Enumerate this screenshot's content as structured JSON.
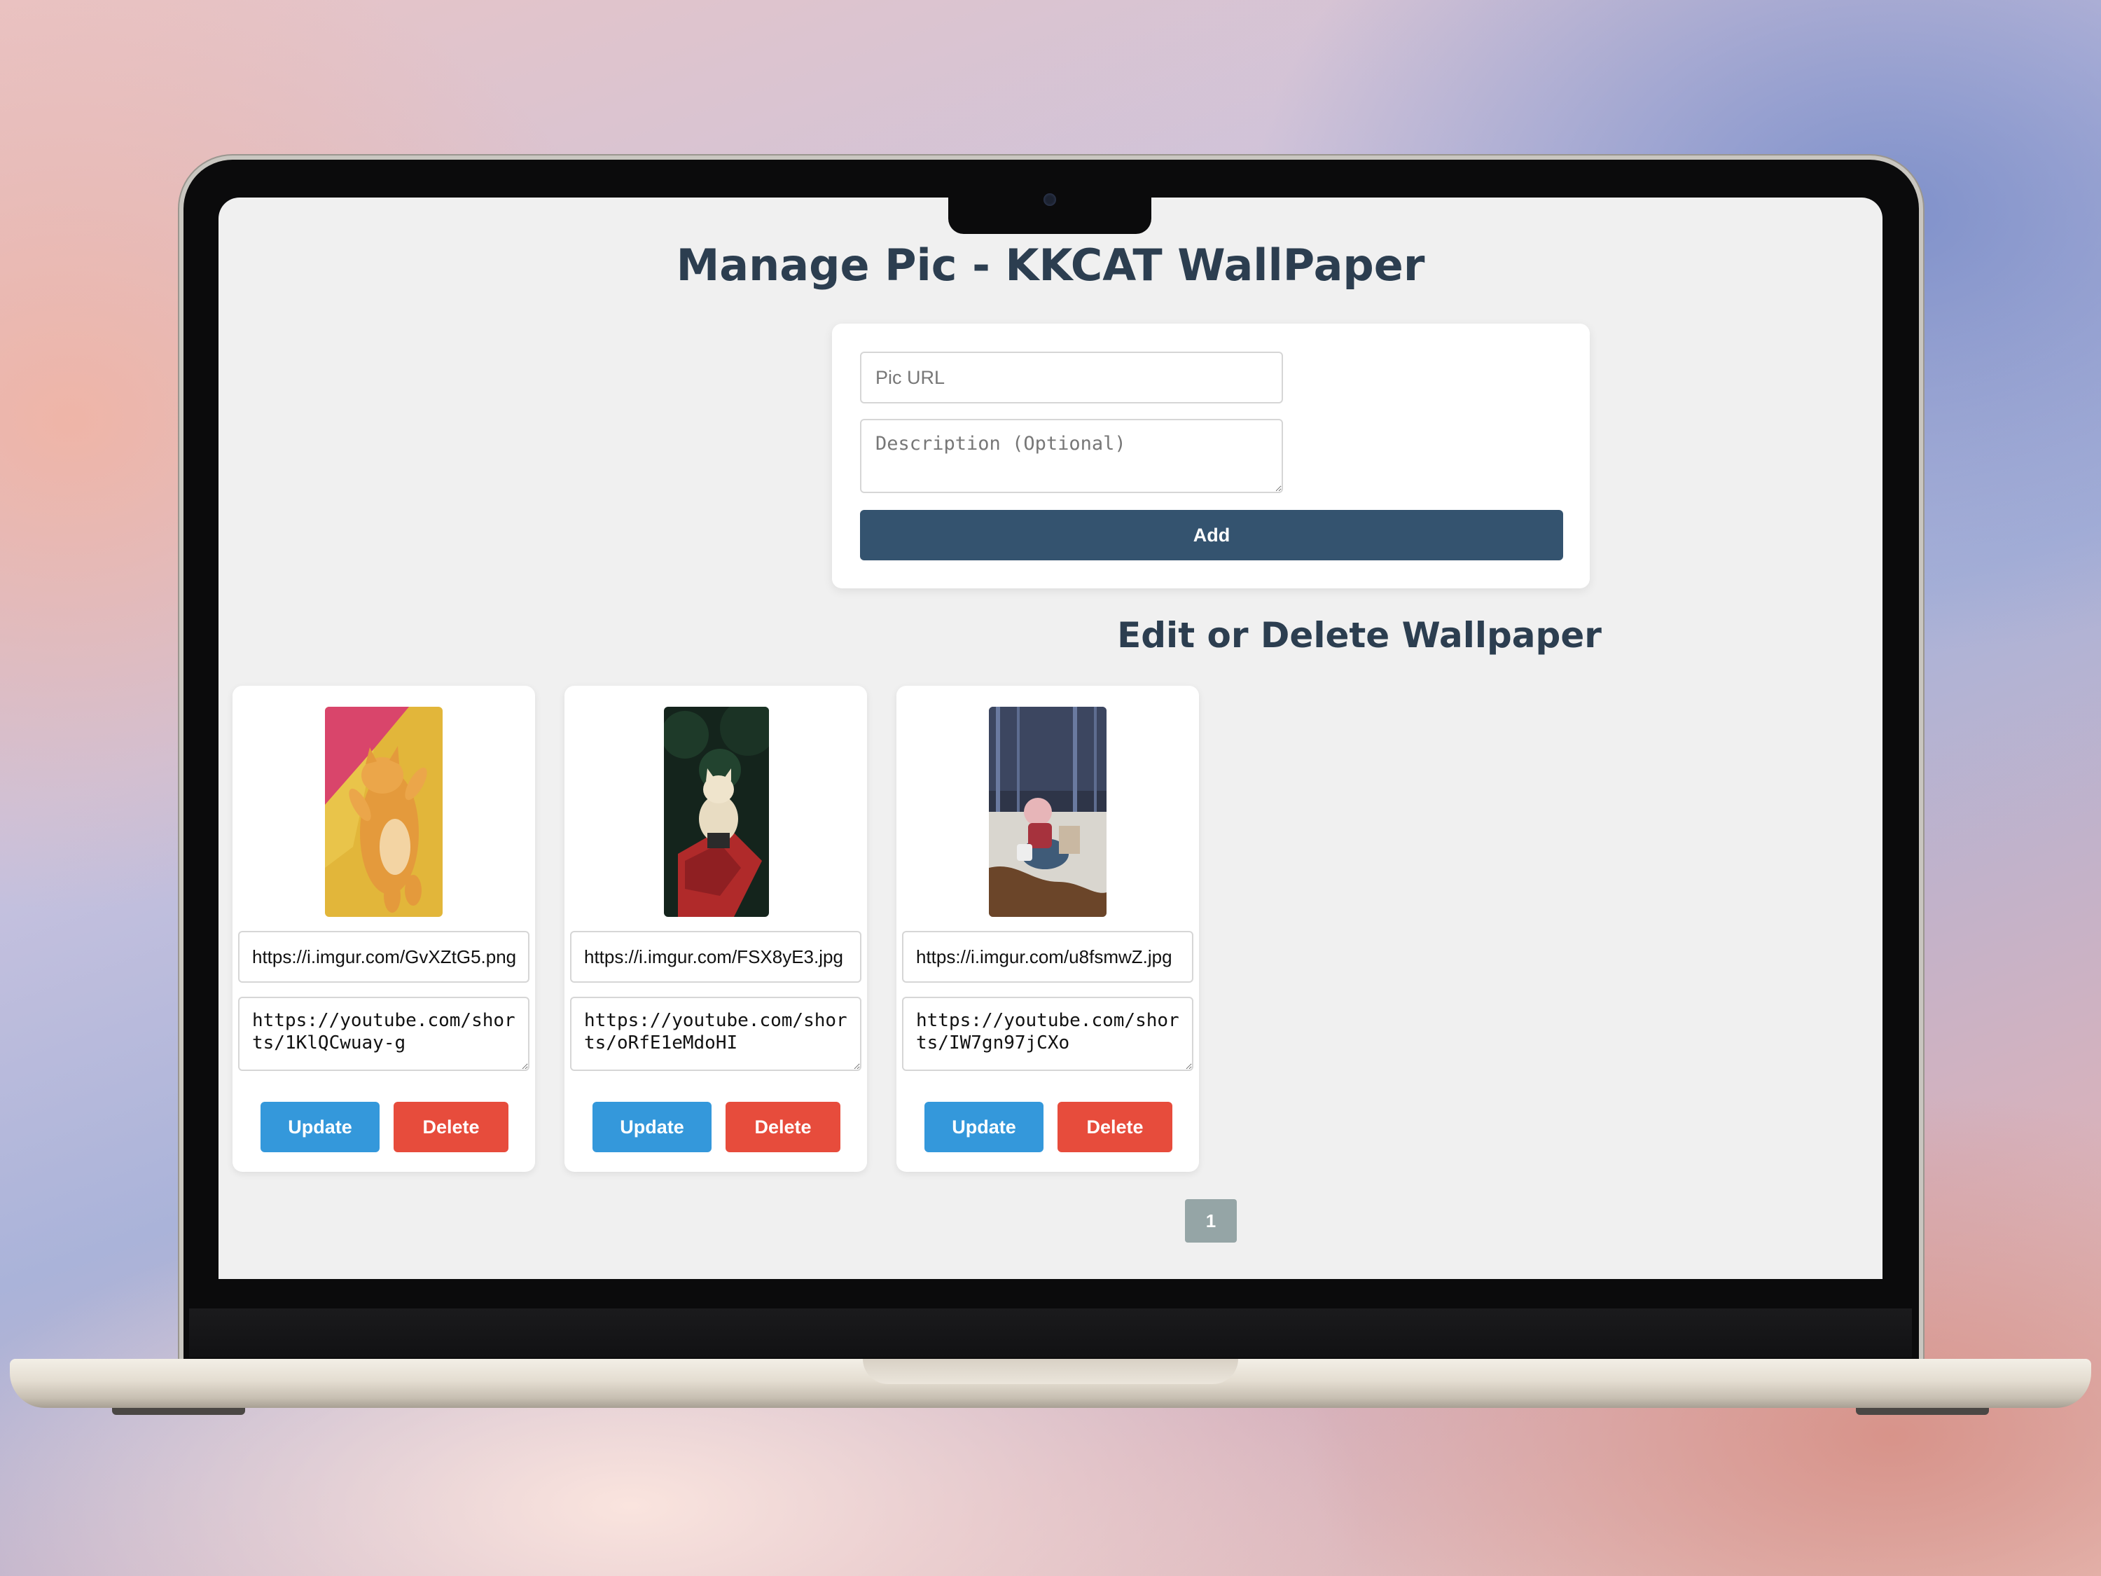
{
  "page": {
    "title": "Manage Pic - KKCAT WallPaper",
    "subtitle": "Edit or Delete Wallpaper"
  },
  "form": {
    "url_placeholder": "Pic URL",
    "desc_placeholder": "Description (Optional)",
    "add_label": "Add"
  },
  "wallpapers": [
    {
      "url": "https://i.imgur.com/GvXZtG5.png",
      "description": "https://youtube.com/shorts/1KlQCwuay-g",
      "thumb": "orange-cat-on-pink-yellow",
      "update_label": "Update",
      "delete_label": "Delete"
    },
    {
      "url": "https://i.imgur.com/FSX8yE3.jpg",
      "description": "https://youtube.com/shorts/oRfE1eMdoHI",
      "thumb": "cat-in-red-car-forest",
      "update_label": "Update",
      "delete_label": "Delete"
    },
    {
      "url": "https://i.imgur.com/u8fsmwZ.jpg",
      "description": "https://youtube.com/shorts/IW7gn97jCXo",
      "thumb": "anime-girl-spilled-coffee",
      "update_label": "Update",
      "delete_label": "Delete"
    }
  ],
  "pagination": {
    "current": "1"
  },
  "colors": {
    "primary": "#34536f",
    "update": "#3498db",
    "delete": "#e74c3c",
    "heading": "#2c3e50",
    "page_button": "#95a5a6"
  }
}
